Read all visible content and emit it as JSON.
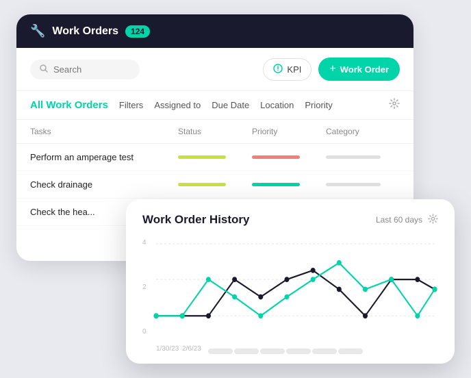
{
  "header": {
    "icon": "🔧",
    "title": "Work Orders",
    "badge": "124"
  },
  "toolbar": {
    "search_placeholder": "Search",
    "kpi_label": "KPI",
    "add_label": "Work Order"
  },
  "filters": {
    "title": "All Work Orders",
    "items": [
      "Filters",
      "Assigned to",
      "Due Date",
      "Location",
      "Priority"
    ]
  },
  "table": {
    "columns": [
      "Tasks",
      "Status",
      "Priority",
      "Category"
    ],
    "rows": [
      {
        "task": "Perform an amperage test",
        "status_color": "yellow",
        "priority_color": "red"
      },
      {
        "task": "Check drainage",
        "status_color": "yellow",
        "priority_color": "green"
      },
      {
        "task": "Check the hea...",
        "status_color": "yellow",
        "priority_color": "green"
      }
    ]
  },
  "history": {
    "title": "Work Order History",
    "period": "Last 60 days",
    "y_labels": [
      "4",
      "2",
      "0"
    ],
    "x_labels": [
      "1/30/23",
      "2/6/23",
      "",
      "",
      "",
      "",
      "",
      ""
    ],
    "chart": {
      "teal_points": [
        [
          0,
          135
        ],
        [
          38,
          135
        ],
        [
          76,
          75
        ],
        [
          114,
          105
        ],
        [
          152,
          135
        ],
        [
          190,
          105
        ],
        [
          228,
          75
        ],
        [
          266,
          45
        ],
        [
          304,
          90
        ],
        [
          342,
          75
        ],
        [
          380,
          135
        ],
        [
          418,
          90
        ]
      ],
      "dark_points": [
        [
          0,
          135
        ],
        [
          38,
          135
        ],
        [
          76,
          135
        ],
        [
          114,
          75
        ],
        [
          152,
          105
        ],
        [
          190,
          75
        ],
        [
          228,
          60
        ],
        [
          266,
          90
        ],
        [
          304,
          135
        ],
        [
          342,
          75
        ],
        [
          380,
          75
        ],
        [
          418,
          90
        ]
      ]
    }
  }
}
